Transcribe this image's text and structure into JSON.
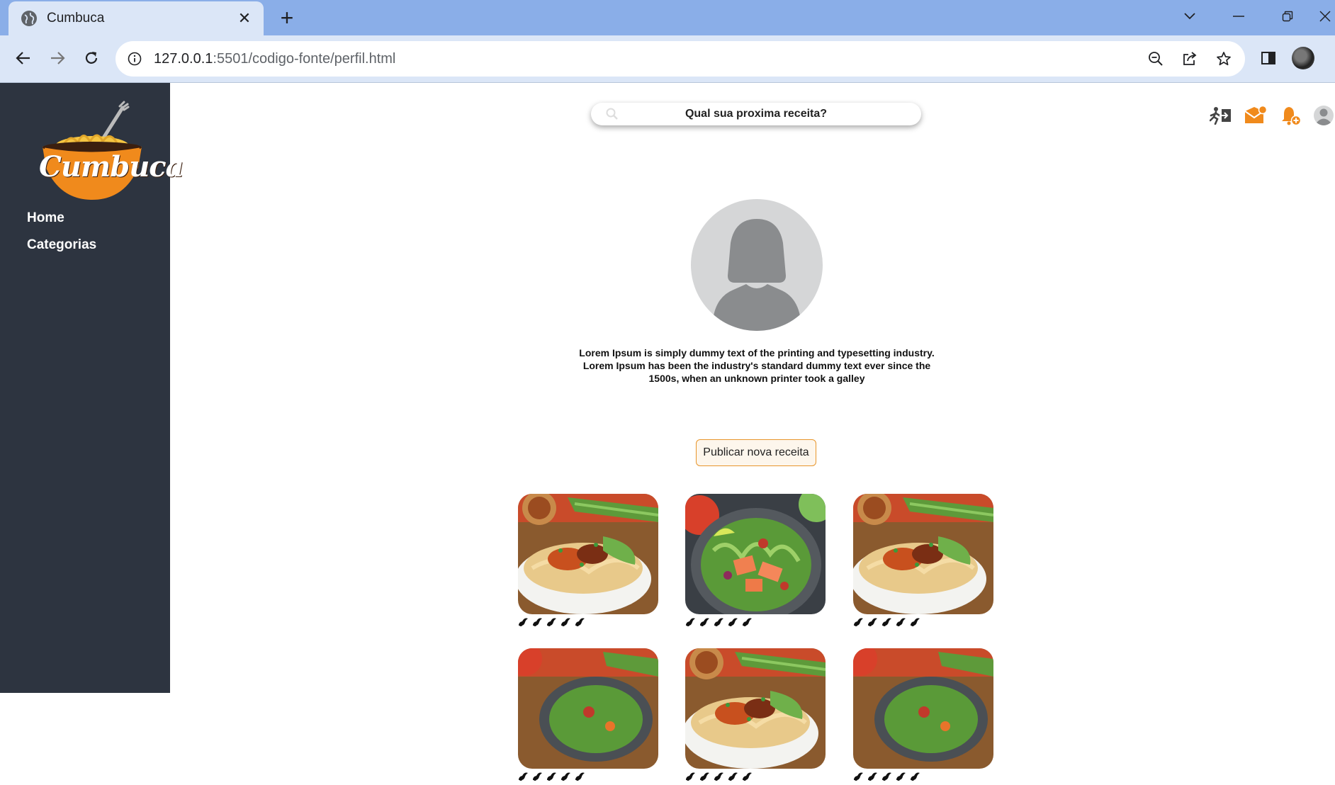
{
  "browser": {
    "tab_title": "Cumbuca",
    "url_host": "127.0.0.1",
    "url_rest": ":5501/codigo-fonte/perfil.html"
  },
  "sidebar": {
    "logo_text": "Cumbuca",
    "items": [
      {
        "label": "Home"
      },
      {
        "label": "Categorias"
      }
    ]
  },
  "header": {
    "search_placeholder": "Qual sua proxima receita?"
  },
  "profile": {
    "bio": "Lorem Ipsum is simply dummy text of the printing and typesetting industry. Lorem Ipsum has been the industry's standard dummy text ever since the 1500s, when an unknown printer took a galley",
    "publish_label": "Publicar nova receita"
  },
  "recipes": [
    {
      "image": "noodle-bowl",
      "rating": 5
    },
    {
      "image": "salmon-salad",
      "rating": 5
    },
    {
      "image": "noodle-bowl",
      "rating": 5
    },
    {
      "image": "salad-bowl",
      "rating": 5
    },
    {
      "image": "noodle-bowl",
      "rating": 5
    },
    {
      "image": "salad-bowl",
      "rating": 5
    }
  ],
  "colors": {
    "sidebar": "#2d3440",
    "accent": "#f08a1c",
    "tabbar": "#8aaee8",
    "toolbar": "#dbe6f7"
  }
}
